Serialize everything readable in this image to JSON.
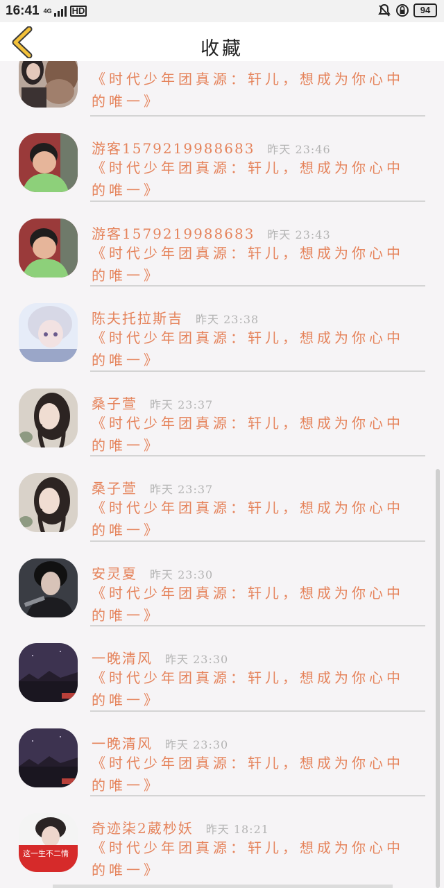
{
  "status_bar": {
    "time": "16:41",
    "network": "4G",
    "hd": "HD",
    "battery": "94"
  },
  "header": {
    "title": "收藏",
    "back_icon": "chevron-left-icon",
    "accent_color": "#f3c13a"
  },
  "colors": {
    "name": "#e5835b",
    "content": "#e5835b",
    "time": "#b3b3b3"
  },
  "items": [
    {
      "name": "",
      "time": "",
      "content": "《时代少年团真源：轩儿，想成为你心中的唯一》",
      "avatar": "avatar-girl-pet"
    },
    {
      "name": "游客1579219988683",
      "time": "昨天 23:46",
      "content": "《时代少年团真源：轩儿，想成为你心中的唯一》",
      "avatar": "avatar-baby"
    },
    {
      "name": "游客1579219988683",
      "time": "昨天 23:43",
      "content": "《时代少年团真源：轩儿，想成为你心中的唯一》",
      "avatar": "avatar-baby"
    },
    {
      "name": "陈夫托拉斯吉",
      "time": "昨天 23:38",
      "content": "《时代少年团真源：轩儿，想成为你心中的唯一》",
      "avatar": "avatar-anime"
    },
    {
      "name": "桑子萱",
      "time": "昨天 23:37",
      "content": "《时代少年团真源：轩儿，想成为你心中的唯一》",
      "avatar": "avatar-girl-braids"
    },
    {
      "name": "桑子萱",
      "time": "昨天 23:37",
      "content": "《时代少年团真源：轩儿，想成为你心中的唯一》",
      "avatar": "avatar-girl-braids"
    },
    {
      "name": "安灵夏",
      "time": "昨天 23:30",
      "content": "《时代少年团真源：轩儿，想成为你心中的唯一》",
      "avatar": "avatar-dark-hair"
    },
    {
      "name": "一晚清风",
      "time": "昨天 23:30",
      "content": "《时代少年团真源：轩儿，想成为你心中的唯一》",
      "avatar": "avatar-night-sky"
    },
    {
      "name": "一晚清风",
      "time": "昨天 23:30",
      "content": "《时代少年团真源：轩儿，想成为你心中的唯一》",
      "avatar": "avatar-night-sky"
    },
    {
      "name": "奇迹柒2葳杪妖",
      "time": "昨天 18:21",
      "content": "《时代少年团真源：轩儿，想成为你心中的唯一》",
      "avatar": "avatar-red-banner",
      "avatar_caption": "这一生不二情"
    }
  ]
}
